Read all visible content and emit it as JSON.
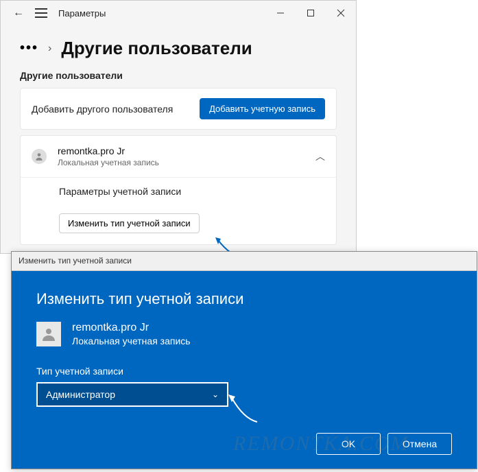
{
  "settings": {
    "title": "Параметры",
    "breadcrumb_dots": "•••",
    "page_title": "Другие пользователи",
    "section_label": "Другие пользователи",
    "add_user_text": "Добавить другого пользователя",
    "add_account_btn": "Добавить учетную запись",
    "user": {
      "name": "remontka.pro Jr",
      "sub": "Локальная учетная запись"
    },
    "account_params_label": "Параметры учетной записи",
    "change_type_btn": "Изменить тип учетной записи"
  },
  "dialog": {
    "titlebar": "Изменить тип учетной записи",
    "heading": "Изменить тип учетной записи",
    "user": {
      "name": "remontka.pro Jr",
      "sub": "Локальная учетная запись"
    },
    "field_label": "Тип учетной записи",
    "select_value": "Администратор",
    "ok": "OK",
    "cancel": "Отмена"
  },
  "watermark": "REMONTKA.COM"
}
